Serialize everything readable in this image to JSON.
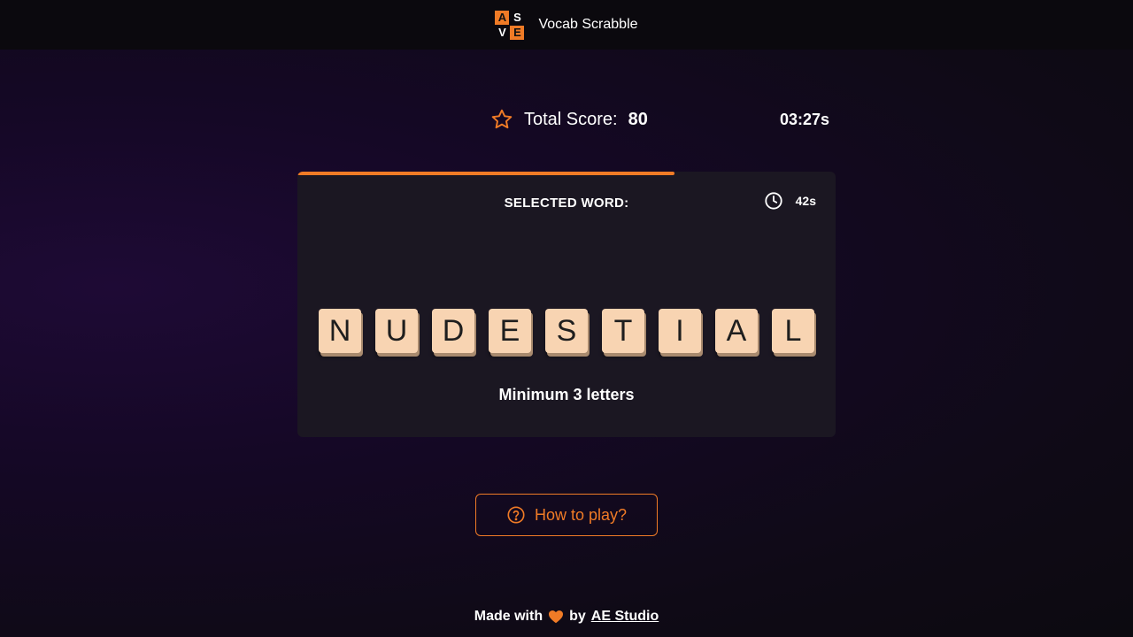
{
  "header": {
    "logo_letters": [
      "A",
      "S",
      "V",
      "E"
    ],
    "title": "Vocab Scrabble"
  },
  "score": {
    "label": "Total Score:",
    "value": "80",
    "icon": "star-icon"
  },
  "total_timer": "03:27s",
  "card": {
    "progress_fraction": 0.7,
    "selected_label": "SELECTED WORD:",
    "round_timer": "42s",
    "round_timer_icon": "clock-icon",
    "tiles": [
      "N",
      "U",
      "D",
      "E",
      "S",
      "T",
      "I",
      "A",
      "L"
    ],
    "hint": "Minimum 3 letters"
  },
  "help_button": {
    "label": "How to play?",
    "icon": "question-circle-icon"
  },
  "footer": {
    "made_with": "Made with",
    "by": "by",
    "link_text": "AE Studio",
    "heart_icon": "heart-icon"
  },
  "colors": {
    "accent": "#f07b26",
    "tile": "#f8d4b2",
    "card": "#1b1722"
  }
}
